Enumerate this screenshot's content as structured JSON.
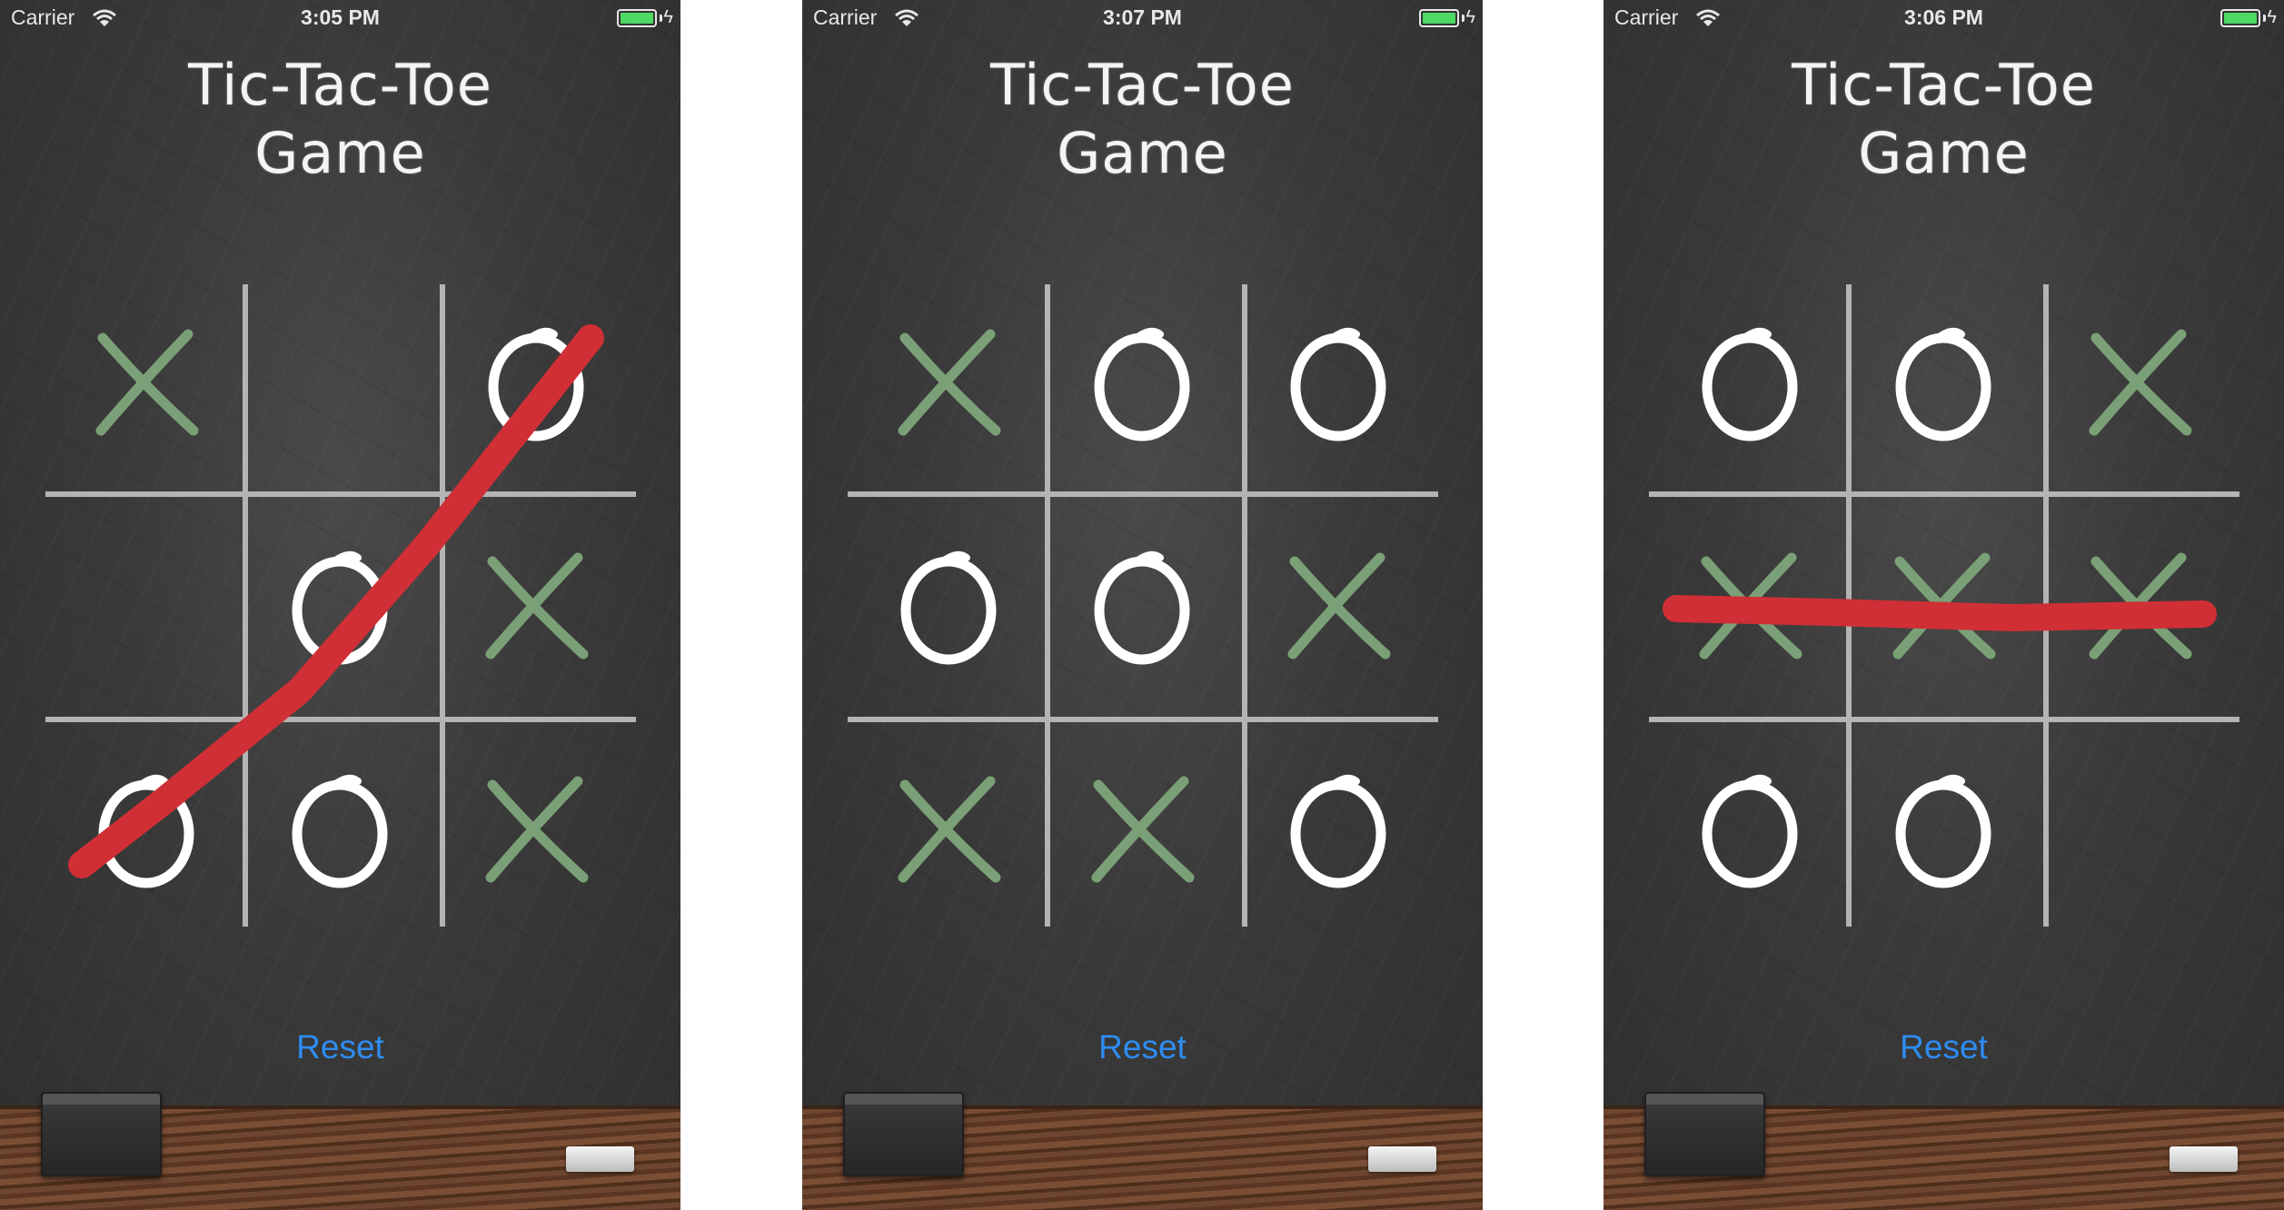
{
  "colors": {
    "x_mark": "#7ba077",
    "o_mark": "#ffffff",
    "win_line": "#cf2f35",
    "reset": "#2e8cf2",
    "grid": "#b4b4b4"
  },
  "screens": [
    {
      "status": {
        "carrier": "Carrier",
        "time": "3:05 PM"
      },
      "title_line1": "Tic-Tac-Toe",
      "title_line2": "Game",
      "board": [
        "X",
        "",
        "O",
        "",
        "O",
        "X",
        "O",
        "O",
        "X"
      ],
      "win_line": "anti-diagonal",
      "reset_label": "Reset"
    },
    {
      "status": {
        "carrier": "Carrier",
        "time": "3:07 PM"
      },
      "title_line1": "Tic-Tac-Toe",
      "title_line2": "Game",
      "board": [
        "X",
        "O",
        "O",
        "O",
        "O",
        "X",
        "X",
        "X",
        "O"
      ],
      "win_line": "none",
      "reset_label": "Reset"
    },
    {
      "status": {
        "carrier": "Carrier",
        "time": "3:06 PM"
      },
      "title_line1": "Tic-Tac-Toe",
      "title_line2": "Game",
      "board": [
        "O",
        "O",
        "X",
        "X",
        "X",
        "X",
        "O",
        "O",
        ""
      ],
      "win_line": "middle-row",
      "reset_label": "Reset"
    }
  ]
}
